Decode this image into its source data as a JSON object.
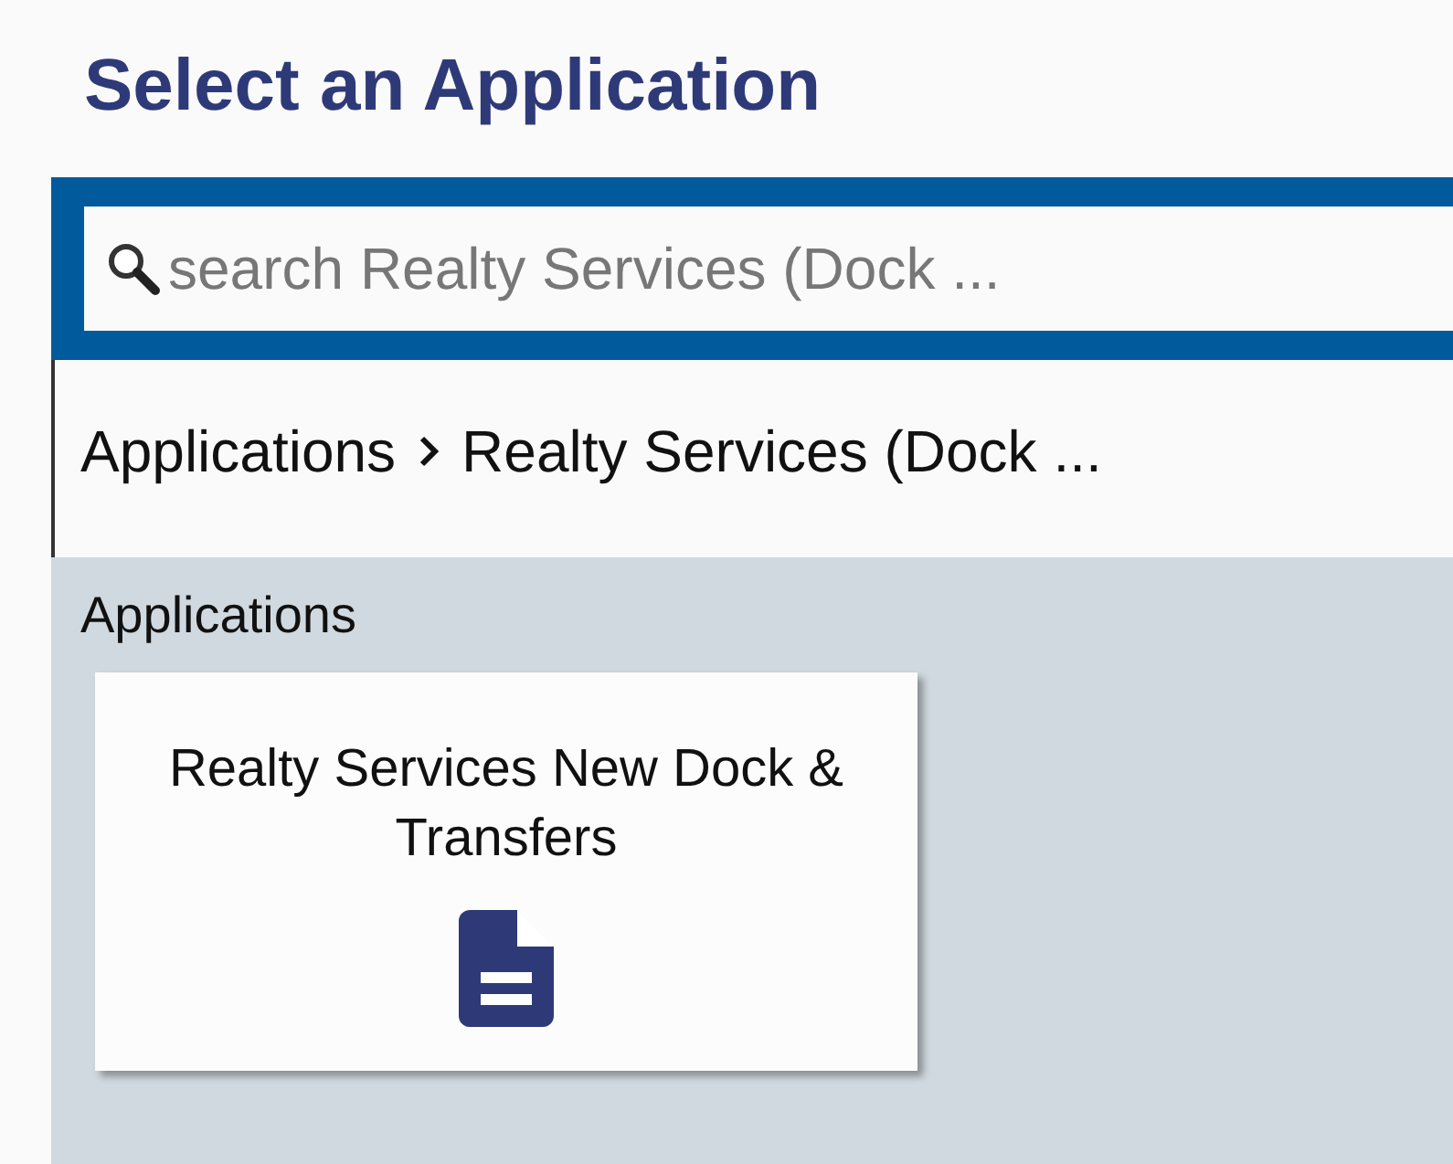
{
  "title": "Select an Application",
  "search": {
    "placeholder": "search Realty Services (Dock ..."
  },
  "breadcrumb": [
    {
      "label": "Applications"
    },
    {
      "label": "Realty Services (Dock ..."
    }
  ],
  "section": {
    "heading": "Applications",
    "cards": [
      {
        "label": "Realty Services New Dock & Transfers",
        "kind": "document"
      }
    ]
  }
}
